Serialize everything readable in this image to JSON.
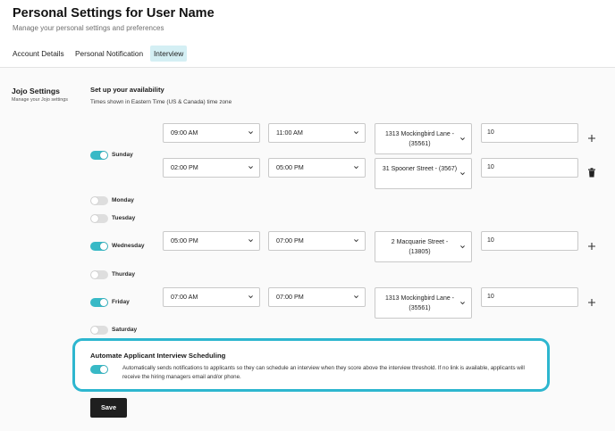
{
  "header": {
    "title": "Personal Settings for User Name",
    "subtitle": "Manage your personal settings and preferences"
  },
  "tabs": [
    {
      "label": "Account Details",
      "active": false
    },
    {
      "label": "Personal Notification",
      "active": false
    },
    {
      "label": "Interview",
      "active": true
    }
  ],
  "section": {
    "title": "Jojo Settings",
    "subtitle": "Manage your Jojo settings"
  },
  "availability": {
    "title": "Set up your availability",
    "timezone_note": "Times shown in Eastern Time (US & Canada) time zone"
  },
  "days": [
    {
      "name": "Sunday",
      "enabled": true,
      "slots": [
        {
          "start": "09:00 AM",
          "end": "11:00 AM",
          "location": "1313 Mockingbird Lane - (35561)",
          "value": "10",
          "action": "add"
        },
        {
          "start": "02:00 PM",
          "end": "05:00 PM",
          "location": "31 Spooner Street - (3567)",
          "value": "10",
          "action": "delete"
        }
      ]
    },
    {
      "name": "Monday",
      "enabled": false,
      "slots": []
    },
    {
      "name": "Tuesday",
      "enabled": false,
      "slots": []
    },
    {
      "name": "Wednesday",
      "enabled": true,
      "slots": [
        {
          "start": "05:00 PM",
          "end": "07:00 PM",
          "location": "2 Macquarie Street - (13805)",
          "value": "10",
          "action": "add"
        }
      ]
    },
    {
      "name": "Thurday",
      "enabled": false,
      "slots": []
    },
    {
      "name": "Friday",
      "enabled": true,
      "slots": [
        {
          "start": "07:00 AM",
          "end": "07:00 PM",
          "location": "1313 Mockingbird Lane - (35561)",
          "value": "10",
          "action": "add"
        }
      ]
    },
    {
      "name": "Saturday",
      "enabled": false,
      "slots": []
    }
  ],
  "automate": {
    "title": "Automate Applicant Interview Scheduling",
    "enabled": true,
    "description": "Automatically sends notifications to applicants so they can schedule an interview when they score above the interview threshold. If no link is available, applicants will receive the hiring managers email and/or phone."
  },
  "save_label": "Save",
  "colors": {
    "accent": "#38b9c6",
    "highlight_border": "#2db6cf",
    "active_tab": "#d4eff4",
    "button": "#1f1f1f"
  }
}
